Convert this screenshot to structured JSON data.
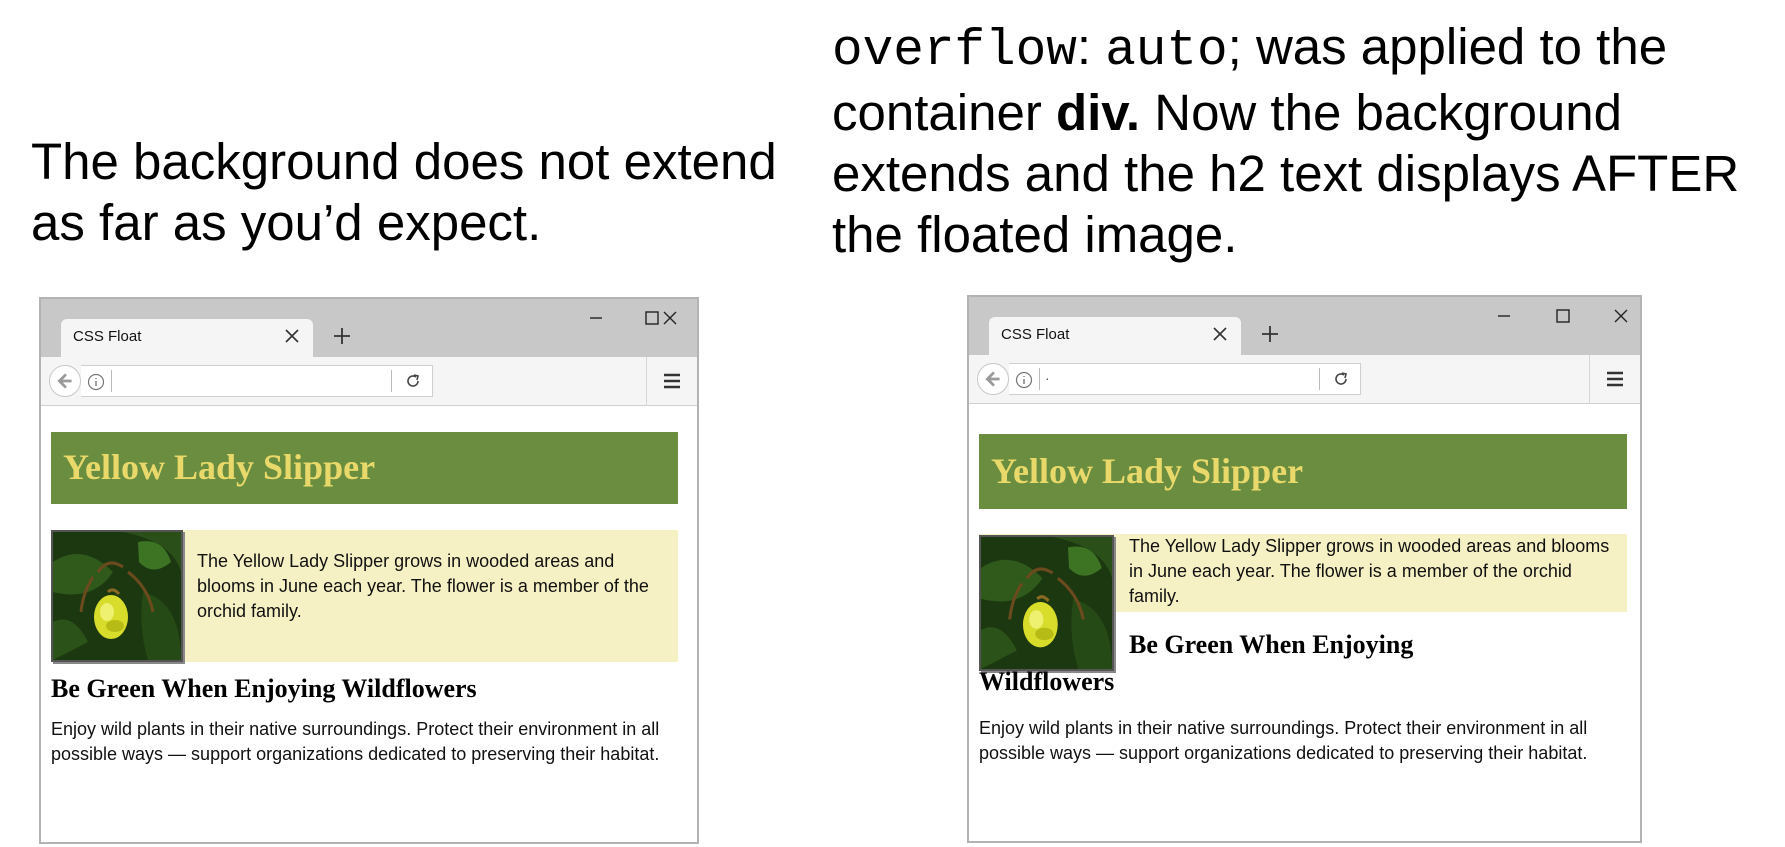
{
  "captions": {
    "left_text": "The background does not extend as far as you’d expect.",
    "right_code1": "overflow",
    "right_colon": ":",
    "right_code2": "auto",
    "right_text1": "; was applied to the container",
    "right_bold": "div.",
    "right_text2": " Now the background extends and the  h2 text displays AFTER the floated image."
  },
  "browser_left": {
    "tab_title": "CSS Float",
    "url": "",
    "page": {
      "heading": "Yellow Lady Slipper",
      "float_text": "The Yellow Lady Slipper grows in wooded areas and blooms in June each year. The flower is a member of the orchid family.",
      "subheading": "Be Green When Enjoying Wildflowers",
      "paragraph": "Enjoy wild plants in their native surroundings. Protect their environment in all possible ways — support organizations dedicated to preserving their habitat."
    }
  },
  "browser_right": {
    "tab_title": "CSS Float",
    "url": "·",
    "page": {
      "heading": "Yellow Lady Slipper",
      "float_text": "The Yellow Lady Slipper grows in wooded areas and blooms in June each year. The flower is a member of the orchid family.",
      "subheading_line1": "Be Green When Enjoying",
      "subheading_line2": "Wildflowers",
      "paragraph": "Enjoy wild plants in their native surroundings. Protect their environment in all possible ways — support organizations dedicated to preserving their habitat."
    }
  },
  "icons": {
    "back": "arrow-left-icon",
    "info": "info-icon",
    "reload": "reload-icon",
    "menu": "hamburger-menu-icon",
    "tab_close": "close-icon",
    "new_tab": "plus-icon",
    "minimize": "minimize-icon",
    "maximize": "maximize-icon",
    "close_window": "close-icon"
  },
  "colors": {
    "heading_bg": "#6a8d3f",
    "heading_text": "#e8d96a",
    "float_bg": "#f6f1c4",
    "chrome_bg": "#c8c8c8"
  }
}
